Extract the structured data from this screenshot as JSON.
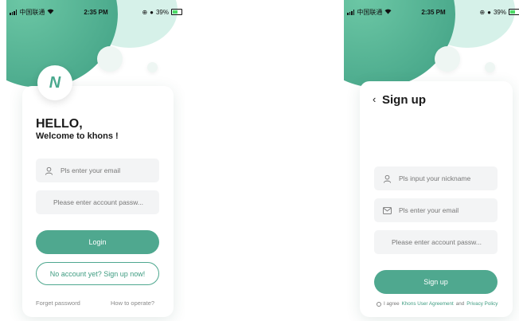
{
  "status_bar": {
    "carrier": "中国联通",
    "time": "2:35 PM",
    "battery": "39%"
  },
  "login": {
    "logo_text": "N",
    "greeting_line1": "HELLO,",
    "greeting_line2": "Welcome to khons !",
    "email_placeholder": "Pls enter your email",
    "password_placeholder": "Please enter account passw...",
    "login_button": "Login",
    "signup_button": "No account yet? Sign up now!",
    "forget_password": "Forget password",
    "how_to_operate": "How to operate?"
  },
  "signup": {
    "title": "Sign up",
    "nickname_placeholder": "Pls input your nickname",
    "email_placeholder": "Pls enter your email",
    "password_placeholder": "Please enter account passw...",
    "signup_button": "Sign up",
    "agree_prefix": "I agree",
    "user_agreement": "Khons User Agreement",
    "and": "and",
    "privacy_policy": "Privacy Policy"
  },
  "colors": {
    "accent": "#4fa88f",
    "accent_dark": "#3e9c81",
    "field_bg": "#f3f4f5"
  }
}
